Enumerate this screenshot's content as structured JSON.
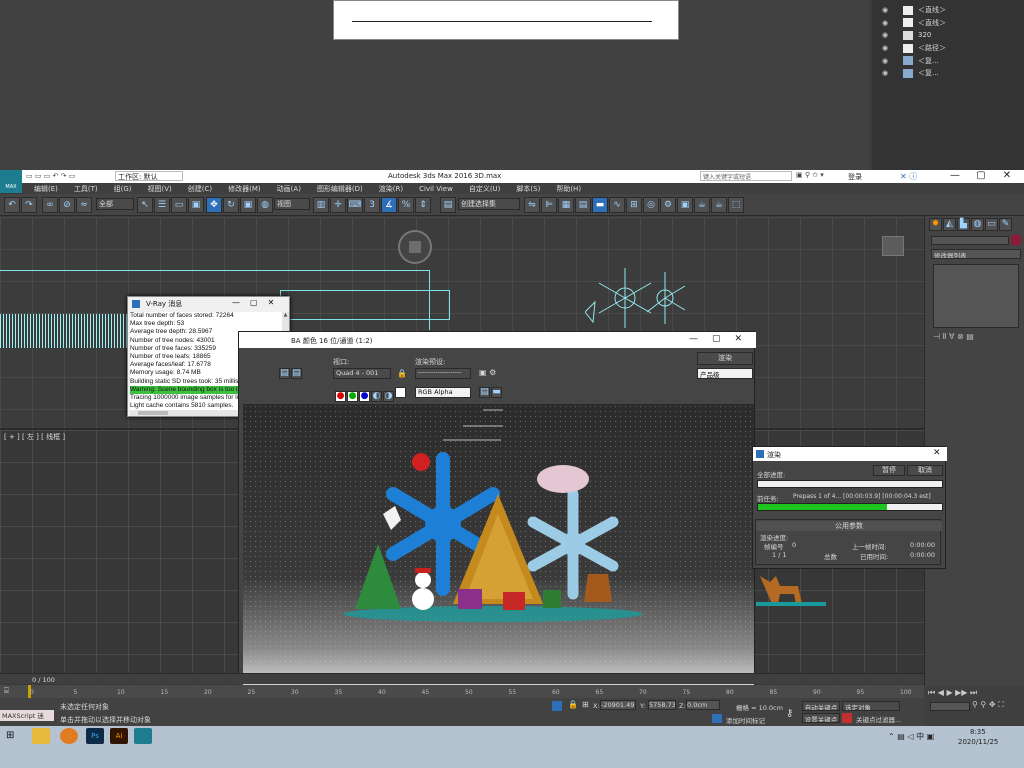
{
  "bg_layers": {
    "rows": [
      {
        "label": "＜直线＞"
      },
      {
        "label": "＜直线＞"
      },
      {
        "label": "320"
      },
      {
        "label": "＜路径＞"
      },
      {
        "label": "＜复..."
      },
      {
        "label": "＜复..."
      }
    ]
  },
  "titlebar": {
    "workspace_label": "工作区: 默认",
    "app_title": "Autodesk 3ds Max 2016",
    "file_name": "3D.max",
    "search_placeholder": "键入关键字或短语",
    "login_label": "登录",
    "logo_text": "MAX"
  },
  "menubar": {
    "items": [
      "编辑(E)",
      "工具(T)",
      "组(G)",
      "视图(V)",
      "创建(C)",
      "修改器(M)",
      "动画(A)",
      "图形编辑器(D)",
      "渲染(R)",
      "Civil View",
      "自定义(U)",
      "脚本(S)",
      "帮助(H)"
    ]
  },
  "main_toolbar": {
    "selection_filter": "全部",
    "view_dropdown": "视图",
    "selection_set": "创建选择集"
  },
  "right_panel": {
    "modifier_list": "修改器列表"
  },
  "viewport": {
    "label": "[ + ] [ 左 ] [ 线框 ]"
  },
  "vray_window": {
    "title": "V-Ray 消息",
    "lines": [
      "Total number of faces stored: 72264",
      "Max tree depth: 53",
      "Average tree depth: 28.5967",
      "Number of tree nodes: 43001",
      "Number of tree faces: 335259",
      "Number of tree leafs: 18865",
      "Average faces/leaf: 17.6778",
      "Memory usage: 8.74 MB",
      "Building static SD trees took: 35 milliseconds",
      "Warning: Scene bounding box is too large, possible raycast e",
      "Tracing 1000000 image samples for light cache in 64 passes",
      "Light cache contains 5810 samples.",
      "Light cache takes 5.2 MB",
      "Average rays per light cache sample: 406.91 (min 1, max 31"
    ],
    "highlight_index": 9
  },
  "frame_buffer": {
    "title": "BA 颜色 16 位/通道 (1:2)",
    "viewport_label": "视口:",
    "viewport_value": "Quad 4 - 001",
    "preset_label": "渲染预设:",
    "preset_value": "--------------------",
    "render_button": "渲染",
    "product_level": "产品级",
    "channel": "RGB Alpha"
  },
  "render_progress": {
    "title": "渲染",
    "pause_button": "暂停",
    "cancel_button": "取消",
    "overall_label": "全部进度:",
    "current_task_label": "前任务:",
    "current_task_value": "Prepass 1 of 4... [00:00:03.9] [00:00:04.3 est]",
    "current_progress": 0.7,
    "section_title": "公用参数",
    "render_progress_label": "渲染进度:",
    "frame_label": "帧编号",
    "frame_value": "0",
    "count_value": "1 / 1",
    "total_label": "总数",
    "last_frame_label": "上一帧时间:",
    "last_frame_value": "0:00:00",
    "elapsed_label": "已用时间:",
    "elapsed_value": "0:00:00"
  },
  "timeline": {
    "frame_display": "0 / 100",
    "ticks": [
      "0",
      "5",
      "10",
      "15",
      "20",
      "25",
      "30",
      "35",
      "40",
      "45",
      "50",
      "55",
      "60",
      "65",
      "70",
      "75",
      "80",
      "85",
      "90",
      "95",
      "100"
    ]
  },
  "status": {
    "maxscript": "MAXScript 迷",
    "no_selection": "未选定任何对象",
    "hint": "单击并拖动以选择并移动对象",
    "x_label": "X:",
    "x_value": "-20901.49",
    "y_label": "Y:",
    "y_value": "5758.73",
    "z_label": "Z:",
    "z_value": "0.0cm",
    "grid": "栅格 = 10.0cm",
    "add_time_tag": "添加时间标记",
    "auto_key": "自动关键点",
    "selected_obj": "选定对象",
    "set_key": "设置关键点",
    "key_filter": "关键点过滤器..."
  },
  "taskbar": {
    "time": "8:35",
    "date": "2020/11/25",
    "lang": "中"
  },
  "colors": {
    "vray_highlight": "#3fbf3f",
    "progress_green": "#1fc41f",
    "accent_blue": "#2d6fb8"
  }
}
